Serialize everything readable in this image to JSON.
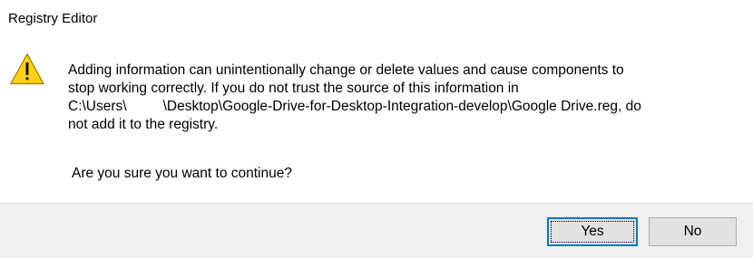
{
  "dialog": {
    "title": "Registry Editor",
    "icon": "warning-icon",
    "message_lines": [
      "Adding information can unintentionally change or delete values and cause components to",
      "stop working correctly. If you do not trust the source of this information in"
    ],
    "path_prefix": "C:\\Users\\",
    "path_suffix": "\\Desktop\\Google-Drive-for-Desktop-Integration-develop\\Google Drive.reg, do",
    "message_last_line": "not add it to the registry.",
    "question": "Are you sure you want to continue?",
    "buttons": {
      "yes_label": "Yes",
      "no_label": "No"
    }
  },
  "colors": {
    "warning_yellow": "#fcd116",
    "focus_border": "#0078d7",
    "footer_bg": "#f0f0f0"
  }
}
